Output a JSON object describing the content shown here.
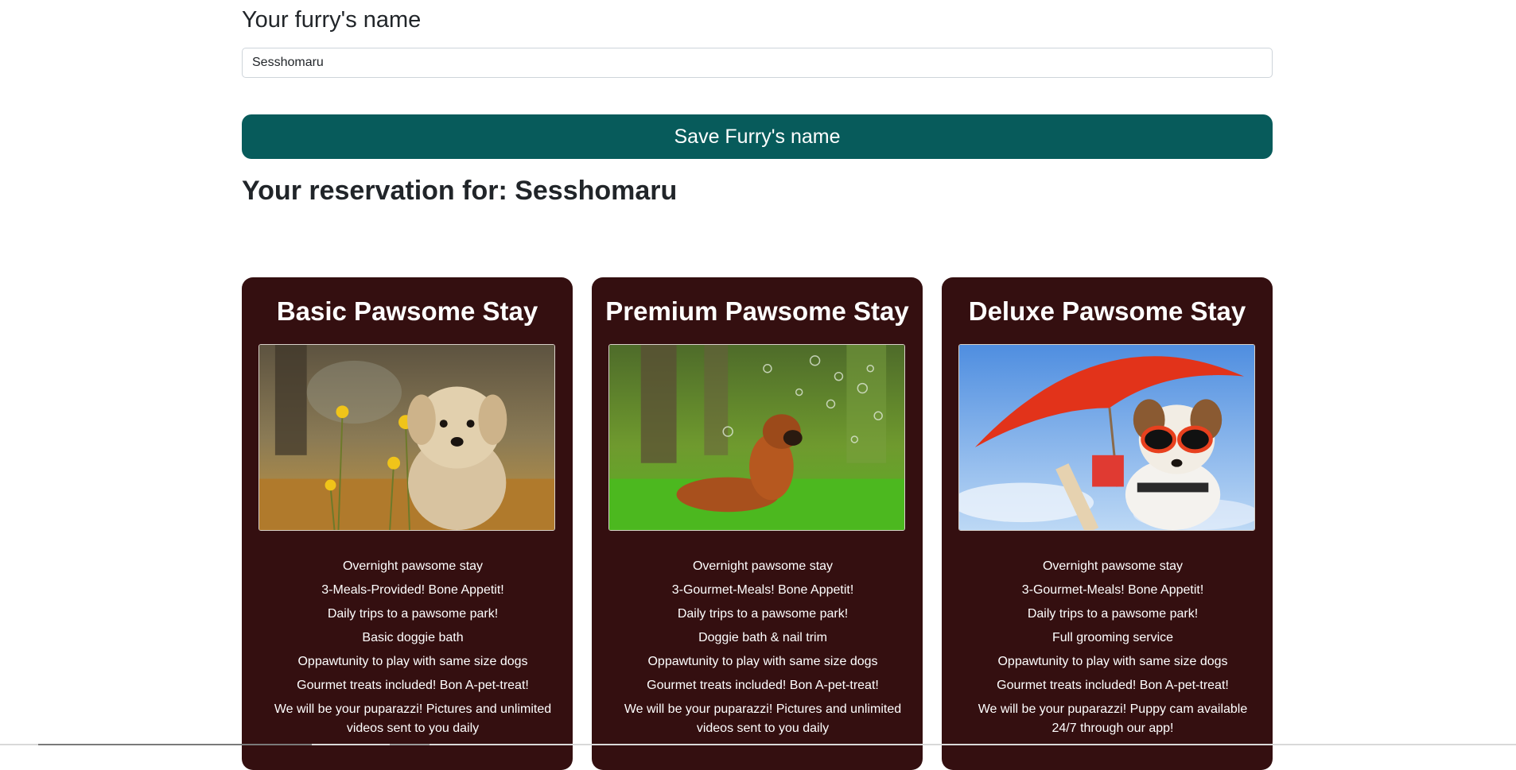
{
  "form": {
    "label": "Your furry's name",
    "input_value": "Sesshomaru",
    "save_label": "Save Furry's name"
  },
  "reservation": {
    "title": "Your reservation for: Sesshomaru"
  },
  "packages": [
    {
      "title": "Basic Pawsome Stay",
      "image": "fluffy-puppy-in-dandelions-photo",
      "features": [
        "Overnight pawsome stay",
        "3-Meals-Provided! Bone Appetit!",
        "Daily trips to a pawsome park!",
        "Basic doggie bath",
        "Oppawtunity to play with same size dogs",
        "Gourmet treats included! Bon A-pet-treat!",
        "We will be your puparazzi! Pictures and unlimited videos sent to you daily"
      ]
    },
    {
      "title": "Premium Pawsome Stay",
      "image": "boxer-dog-in-grass-with-bubbles-photo",
      "features": [
        "Overnight pawsome stay",
        "3-Gourmet-Meals! Bone Appetit!",
        "Daily trips to a pawsome park!",
        "Doggie bath & nail trim",
        "Oppawtunity to play with same size dogs",
        "Gourmet treats included! Bon A-pet-treat!",
        "We will be your puparazzi! Pictures and unlimited videos sent to you daily"
      ]
    },
    {
      "title": "Deluxe Pawsome Stay",
      "image": "dog-with-sunglasses-under-umbrella-photo",
      "features": [
        "Overnight pawsome stay",
        "3-Gourmet-Meals! Bone Appetit!",
        "Daily trips to a pawsome park!",
        "Full grooming service",
        "Oppawtunity to play with same size dogs",
        "Gourmet treats included! Bon A-pet-treat!",
        "We will be your puparazzi! Puppy cam available 24/7 through our app!"
      ]
    }
  ],
  "colors": {
    "primary_button": "#075b5b",
    "card_background": "#340f10",
    "card_text": "#ffffff"
  }
}
